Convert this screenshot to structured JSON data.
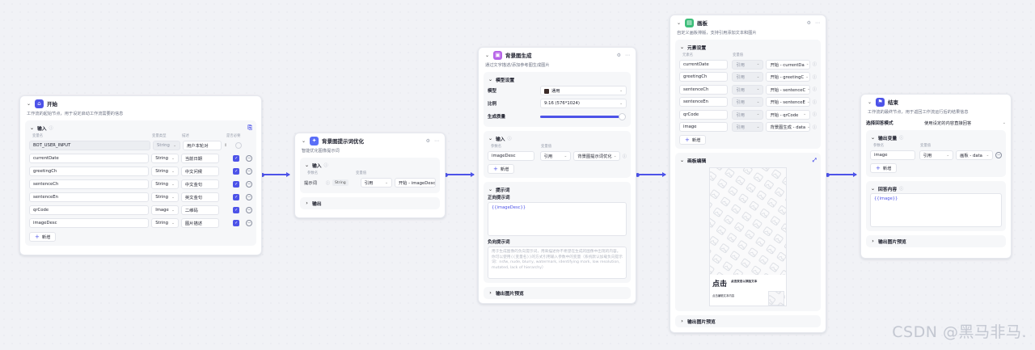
{
  "colors": {
    "accent": "#4d53e8",
    "start_icon": "#4d53e8",
    "prompt_icon": "#5a6ef7",
    "image_icon": "#b765e8",
    "canvas_icon": "#3dbe7a",
    "end_icon": "#4d53e8"
  },
  "start": {
    "title": "开始",
    "desc": "工作流的起始节点，用于设定启动工作流需要的信息",
    "section": "输入",
    "cols": {
      "name": "变量名",
      "type": "变量类型",
      "desc": "描述",
      "required": "是否必要"
    },
    "rows": [
      {
        "name": "BOT_USER_INPUT",
        "type": "String",
        "desc": "用户本轮对",
        "required": false,
        "locked": true
      },
      {
        "name": "currentDate",
        "type": "String",
        "desc": "当前日期",
        "required": true
      },
      {
        "name": "greetingCh",
        "type": "String",
        "desc": "中文问候",
        "required": true
      },
      {
        "name": "sentenceCh",
        "type": "String",
        "desc": "中文金句",
        "required": true
      },
      {
        "name": "sentenceEn",
        "type": "String",
        "desc": "英文金句",
        "required": true
      },
      {
        "name": "qrCode",
        "type": "Image",
        "desc": "二维码",
        "required": true
      },
      {
        "name": "imageDesc",
        "type": "String",
        "desc": "图片描述",
        "required": true
      }
    ],
    "add_label": "新增"
  },
  "prompt": {
    "title": "背景图提示词优化",
    "desc": "智能优化图像提示词",
    "section": "输入",
    "cols": {
      "name": "参数名",
      "value": "变量值"
    },
    "param_name": "提示词",
    "param_type": "String",
    "ref": "引用",
    "ref_value": "开始 - imageDesc",
    "output": "输出"
  },
  "image": {
    "title": "背景图生成",
    "desc": "通过文字描述/添加参考图生成图片",
    "model_section": "模型设置",
    "model_label": "模型",
    "model_value": "通用",
    "ratio_label": "比例",
    "ratio_value": "9:16 (576*1024)",
    "quality_label": "生成质量",
    "quality_level": 1.0,
    "input_section": "输入",
    "cols": {
      "name": "参数名",
      "value": "变量值"
    },
    "input_name": "imageDesc",
    "ref": "引用",
    "ref_value": "背景图提示词优化",
    "add_label": "新增",
    "prompt_section": "提示词",
    "positive_label": "正向提示词",
    "positive_value": "{{imageDesc}}",
    "negative_label": "负向提示词",
    "negative_value": "用于生成图像的负向提示词，用来描述你不希望在生成的图像中出现的内容。你可以使用{{变量名}}的方式引用输入参数中的变量（系统默认加载负向提示词：nsfw, nude, blurry, watermark, identifying mark, low resolution, mutated, lack of hierarchy）",
    "output": "输出图片预览"
  },
  "canvas": {
    "title": "画板",
    "desc": "自定义画板排版，支持引用添加文本和图片",
    "elements_section": "元素设置",
    "cols": {
      "name": "元素名",
      "value": "变量值"
    },
    "rows": [
      {
        "name": "currentDate",
        "ref": "引用",
        "value": "开始 - currentDa"
      },
      {
        "name": "greetingCh",
        "ref": "引用",
        "value": "开始 - greetingC"
      },
      {
        "name": "sentenceCh",
        "ref": "引用",
        "value": "开始 - sentenceC"
      },
      {
        "name": "sentenceEn",
        "ref": "引用",
        "value": "开始 - sentenceE"
      },
      {
        "name": "qrCode",
        "ref": "引用",
        "value": "开始 - qrCode"
      },
      {
        "name": "image",
        "ref": "引用",
        "value": "背景图生成 - data"
      }
    ],
    "add_label": "新增",
    "edit_section": "画板编辑",
    "preview_big": "点击",
    "preview_line1": "点击双击以添加文本",
    "preview_line2": "点击编辑文本内容",
    "output": "输出图片预览"
  },
  "end": {
    "title": "结束",
    "desc": "工作流的最终节点，用于返回工作流运行后的结果信息",
    "mode_label": "选择回答模式",
    "mode_value": "使用设定的内容直接回答",
    "output_section": "输出变量",
    "cols": {
      "name": "参数名",
      "value": "变量值"
    },
    "var_name": "image",
    "ref": "引用",
    "ref_value": "画板 - data",
    "add_label": "新增",
    "answer_section": "回答内容",
    "answer_value": "{{image}}",
    "output": "输出图片预览"
  },
  "watermark": "CSDN @黑马非马."
}
